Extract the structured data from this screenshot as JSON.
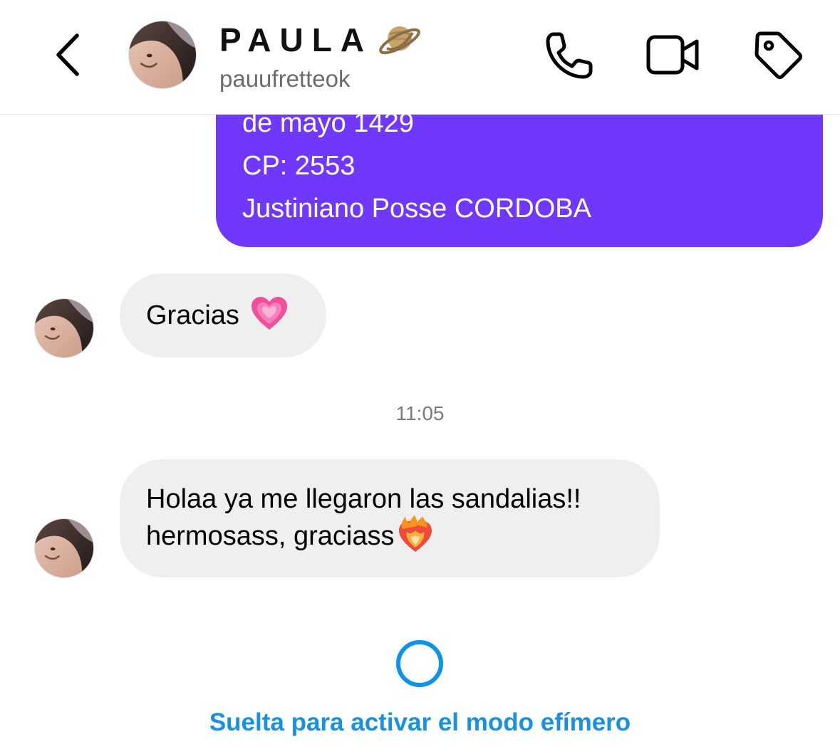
{
  "header": {
    "contact_name": "PAULA",
    "name_emoji": "ringed-planet-icon",
    "username": "pauufretteok",
    "back_icon": "chevron-left-icon",
    "actions": [
      "phone-icon",
      "video-camera-icon",
      "tag-icon"
    ]
  },
  "sent_message": {
    "lines": [
      "de mayo 1429",
      "CP: 2553",
      "Justiniano Posse CORDOBA"
    ]
  },
  "messages": [
    {
      "text": "Gracias",
      "emoji": "growing-heart-icon"
    },
    {
      "line1": "Holaa ya me llegaron las sandalias!!",
      "line2": "hermosass, graciass",
      "emoji": "heart-on-fire-icon"
    }
  ],
  "timestamp": "11:05",
  "vanish_mode": {
    "label": "Suelta para activar el modo efímero"
  },
  "colors": {
    "sent_bubble": "#7038fd",
    "received_bubble": "#efefef",
    "vanish_accent": "#1a91e0"
  }
}
